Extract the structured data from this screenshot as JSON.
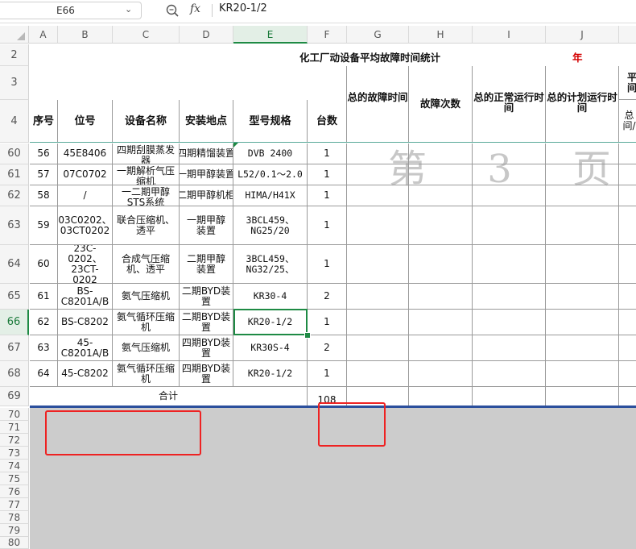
{
  "formula_bar": {
    "name_box": "E66",
    "fx_label": "fx",
    "formula": "KR20-1/2"
  },
  "columns": [
    "A",
    "B",
    "C",
    "D",
    "E",
    "F",
    "G",
    "H",
    "I",
    "J"
  ],
  "title": {
    "text": "化工厂动设备平均故障时间统计",
    "year": "年"
  },
  "headers": {
    "seq": "序号",
    "tag": "位号",
    "name": "设备名称",
    "location": "安装地点",
    "model": "型号规格",
    "count": "台数",
    "total_fault_time": "总的故障时间",
    "fault_count": "故障次数",
    "total_normal_time": "总的正常运行时间",
    "total_planned_time": "总的计划运行时间",
    "k3_partial": "平 间",
    "k4_partial": "总 间/"
  },
  "rows": [
    {
      "row": "60",
      "seq": "56",
      "tag": "45E8406",
      "name": "四期刮膜蒸发器",
      "location": "四期精馏装置",
      "model": "DVB 2400",
      "count": "1"
    },
    {
      "row": "61",
      "seq": "57",
      "tag": "07C0702",
      "name": "一期解析气压缩机",
      "location": "一期甲醇装置",
      "model": "L52/0.1～2.0",
      "count": "1"
    },
    {
      "row": "62",
      "seq": "58",
      "tag": "/",
      "name": "一二期甲醇STS系统",
      "location": "二期甲醇机柜",
      "model": "HIMA/H41X",
      "count": "1"
    },
    {
      "row": "63",
      "seq": "59",
      "tag": "03C0202、03CT0202",
      "name": "联合压缩机、透平",
      "location": "一期甲醇装置",
      "model": "3BCL459、NG25/20",
      "count": "1"
    },
    {
      "row": "64",
      "seq": "60",
      "tag": "23C-0202、23CT-0202",
      "name": "合成气压缩机、透平",
      "location": "二期甲醇装置",
      "model": "3BCL459、NG32/25、",
      "count": "1"
    },
    {
      "row": "65",
      "seq": "61",
      "tag": "BS-C8201A/B",
      "name": "氨气压缩机",
      "location": "二期BYD装置",
      "model": "KR30-4",
      "count": "2"
    },
    {
      "row": "66",
      "seq": "62",
      "tag": "BS-C8202",
      "name": "氨气循环压缩机",
      "location": "二期BYD装置",
      "model": "KR20-1/2",
      "count": "1"
    },
    {
      "row": "67",
      "seq": "63",
      "tag": "45-C8201A/B",
      "name": "氨气压缩机",
      "location": "四期BYD装置",
      "model": "KR30S-4",
      "count": "2"
    },
    {
      "row": "68",
      "seq": "64",
      "tag": "45-C8202",
      "name": "氨气循环压缩机",
      "location": "四期BYD装置",
      "model": "KR20-1/2",
      "count": "1"
    }
  ],
  "total_row": {
    "row": "69",
    "label": "合计",
    "value": "108"
  },
  "row_labels_top": [
    "2",
    "3",
    "4"
  ],
  "empty_rows": [
    "70",
    "71",
    "72",
    "73",
    "74",
    "75",
    "76",
    "77",
    "78",
    "79",
    "80"
  ],
  "watermark": "第 3 页"
}
